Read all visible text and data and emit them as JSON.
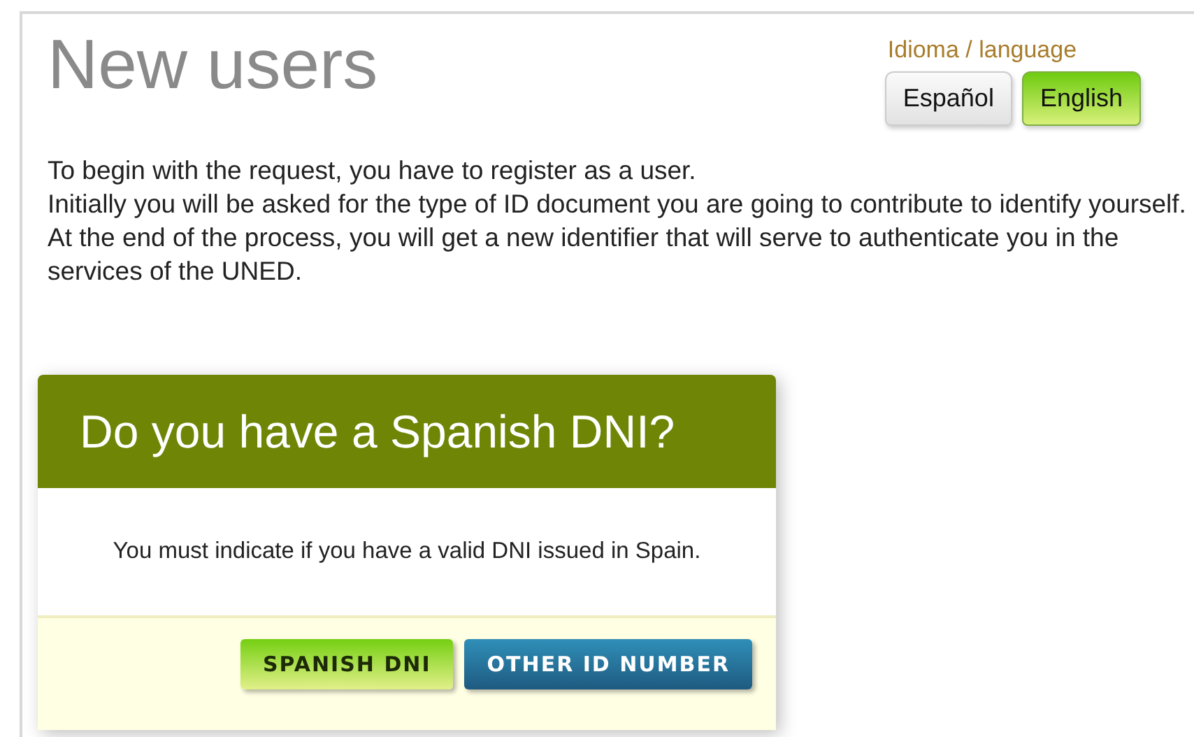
{
  "title": "New users",
  "language": {
    "label": "Idioma / language",
    "options": [
      {
        "label": "Español",
        "selected": false
      },
      {
        "label": "English",
        "selected": true
      }
    ]
  },
  "intro": [
    "To begin with the request, you have to register as a user.",
    "Initially you will be asked for the type of ID document you are going to contribute to identify yourself. At the end of the process, you will get a new identifier that will serve to authenticate you in the services of the UNED."
  ],
  "dialog": {
    "title": "Do you have a Spanish DNI?",
    "message": "You must indicate if you have a valid DNI issued in Spain.",
    "buttons": [
      {
        "label": "SPANISH DNI",
        "kind": "green"
      },
      {
        "label": "OTHER ID NUMBER",
        "kind": "blue"
      }
    ]
  }
}
